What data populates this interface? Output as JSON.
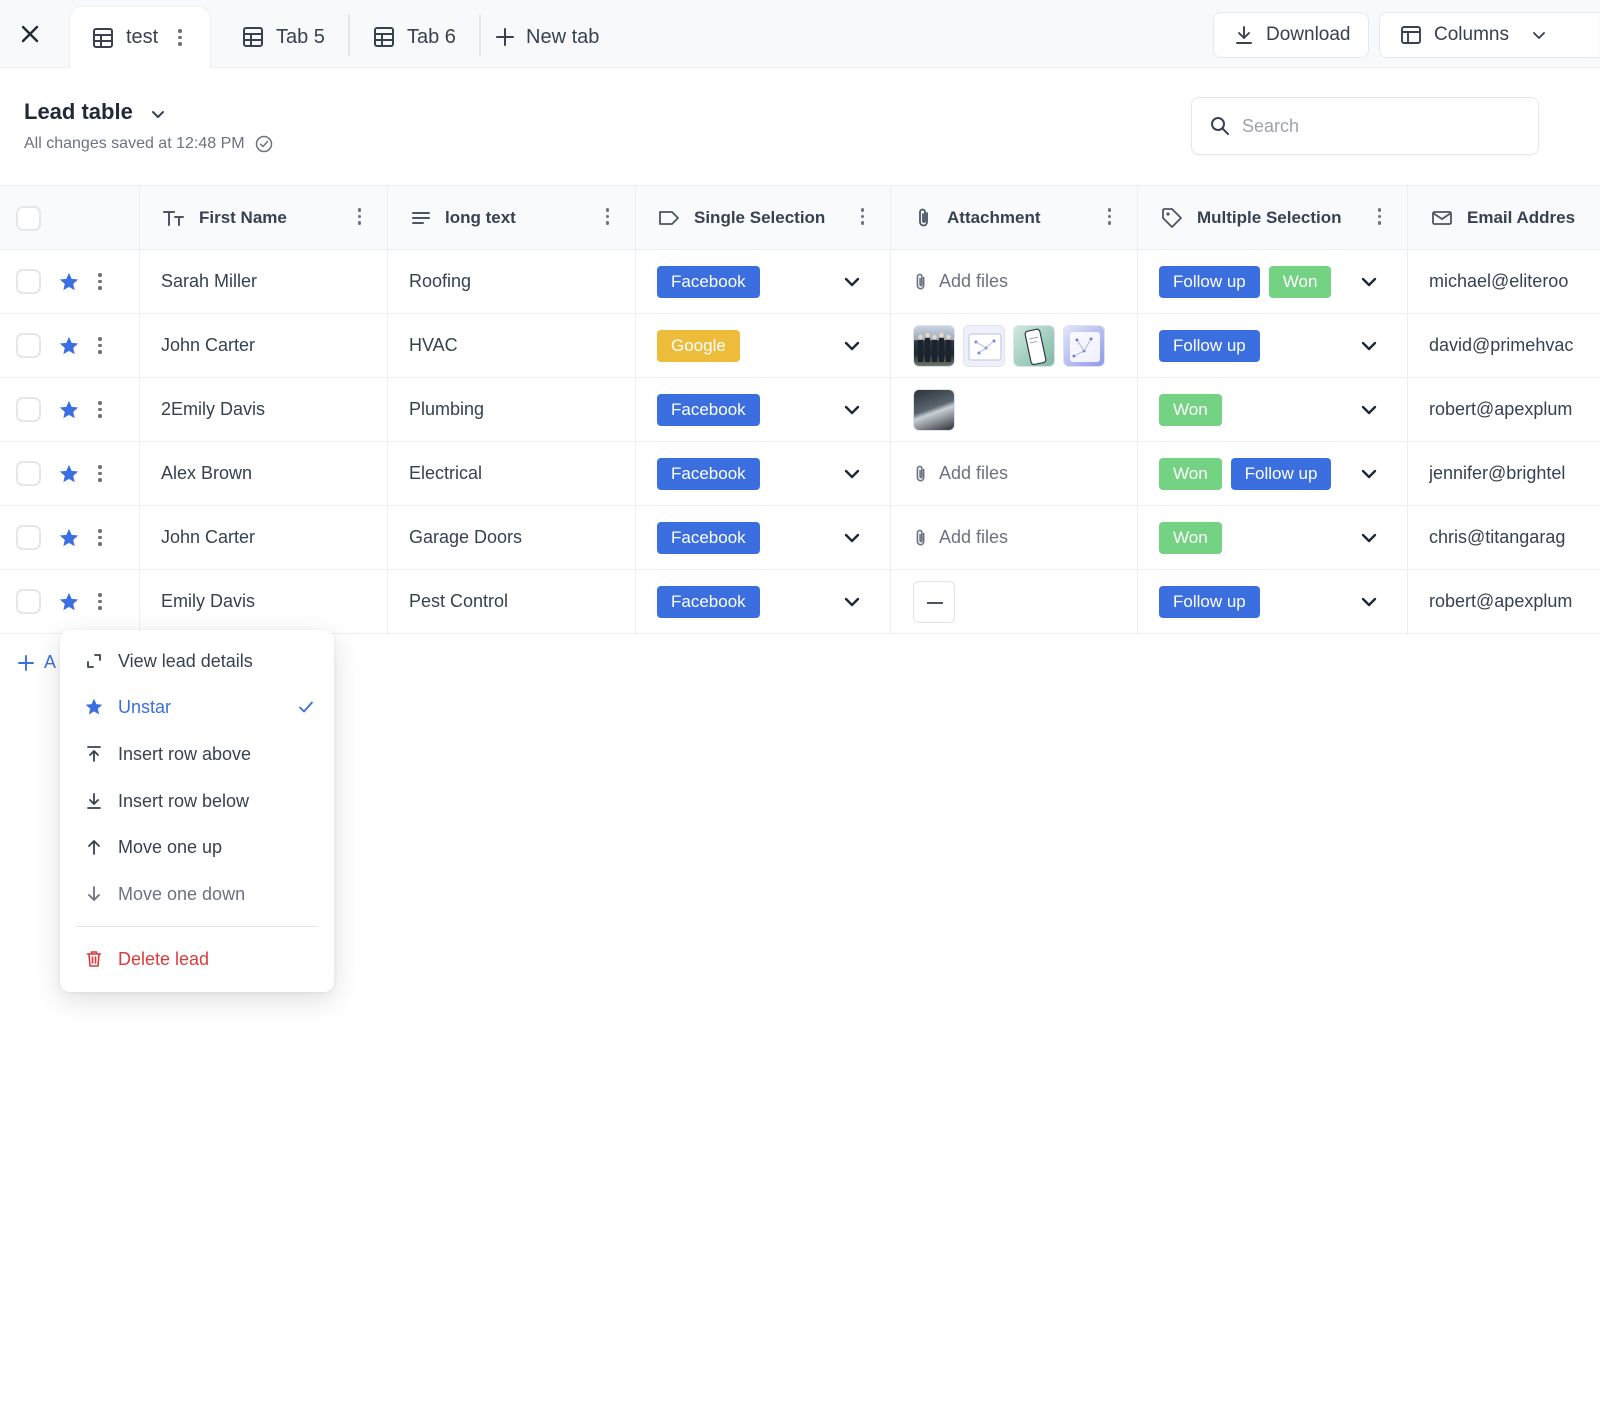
{
  "tabs": {
    "active": {
      "label": "test"
    },
    "items": [
      {
        "label": "Tab 5"
      },
      {
        "label": "Tab 6"
      }
    ],
    "new_tab_label": "New tab"
  },
  "toolbar": {
    "download_label": "Download",
    "columns_label": "Columns"
  },
  "header": {
    "title": "Lead table",
    "saved_status": "All changes saved at 12:48 PM"
  },
  "search": {
    "placeholder": "Search"
  },
  "columns": [
    {
      "label": "First Name",
      "icon": "text-type-icon"
    },
    {
      "label": "long text",
      "icon": "lines-icon"
    },
    {
      "label": "Single Selection",
      "icon": "label-tag-icon"
    },
    {
      "label": "Attachment",
      "icon": "paperclip-icon"
    },
    {
      "label": "Multiple Selection",
      "icon": "tag-icon"
    },
    {
      "label": "Email Addres",
      "icon": "envelope-icon"
    }
  ],
  "rows": [
    {
      "first_name": "Sarah Miller",
      "long_text": "Roofing",
      "single": "Facebook",
      "attachment": "Add files",
      "multi": [
        "Follow up",
        "Won"
      ],
      "email": "michael@eliteroo"
    },
    {
      "first_name": "John Carter",
      "long_text": "HVAC",
      "single": "Google",
      "attachment": "",
      "multi": [
        "Follow up"
      ],
      "email": "david@primehvac"
    },
    {
      "first_name": "2Emily Davis",
      "long_text": "Plumbing",
      "single": "Facebook",
      "attachment": "",
      "multi": [
        "Won"
      ],
      "email": "robert@apexplum"
    },
    {
      "first_name": "Alex Brown",
      "long_text": "Electrical",
      "single": "Facebook",
      "attachment": "Add files",
      "multi": [
        "Won",
        "Follow up"
      ],
      "email": "jennifer@brightel"
    },
    {
      "first_name": "John Carter",
      "long_text": "Garage Doors",
      "single": "Facebook",
      "attachment": "Add files",
      "multi": [
        "Won"
      ],
      "email": "chris@titangarag"
    },
    {
      "first_name": "Emily Davis",
      "long_text": "Pest Control",
      "single": "Facebook",
      "attachment": "",
      "multi": [
        "Follow up"
      ],
      "email": "robert@apexplum"
    }
  ],
  "add_row_label": "A",
  "context_menu": {
    "items": [
      {
        "label": "View lead details",
        "icon": "expand-icon"
      },
      {
        "label": "Unstar",
        "icon": "star-icon",
        "checked": true
      },
      {
        "label": "Insert row above",
        "icon": "insert-above-icon"
      },
      {
        "label": "Insert row below",
        "icon": "insert-below-icon"
      },
      {
        "label": "Move one up",
        "icon": "arrow-up-icon"
      },
      {
        "label": "Move one down",
        "icon": "arrow-down-icon"
      },
      {
        "label": "Delete lead",
        "icon": "trash-icon"
      }
    ]
  },
  "colors": {
    "accent": "#3b6fe0",
    "won": "#74d383",
    "google": "#ecbc3a",
    "danger": "#d93b3b"
  }
}
